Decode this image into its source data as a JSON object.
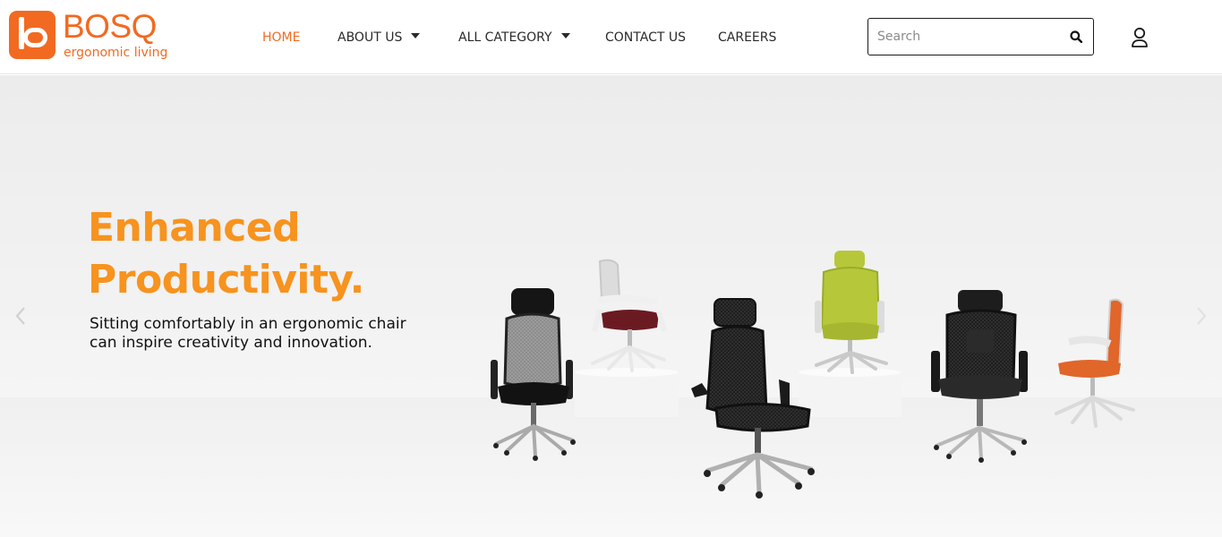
{
  "brand": {
    "name": "BOSQ",
    "tagline": "ergonomic living",
    "color": "#f26a21"
  },
  "nav": {
    "items": [
      {
        "label": "HOME",
        "active": true,
        "dropdown": false
      },
      {
        "label": "ABOUT US",
        "active": false,
        "dropdown": true
      },
      {
        "label": "ALL CATEGORY",
        "active": false,
        "dropdown": true
      },
      {
        "label": "CONTACT US",
        "active": false,
        "dropdown": false
      },
      {
        "label": "CAREERS",
        "active": false,
        "dropdown": false
      }
    ]
  },
  "search": {
    "placeholder": "Search",
    "value": "",
    "icon": "search-icon"
  },
  "account": {
    "icon": "user-icon"
  },
  "hero": {
    "headline_line1": "Enhanced",
    "headline_line2": "Productivity.",
    "subtext_line1": "Sitting comfortably in an ergonomic chair",
    "subtext_line2": "can inspire creativity and innovation.",
    "headline_color": "#f7931e",
    "prev_icon": "chevron-left-icon",
    "next_icon": "chevron-right-icon"
  },
  "products": [
    {
      "name": "grey-mesh-chair",
      "seat_color": "#111111",
      "back_color": "#8c8c8c"
    },
    {
      "name": "white-frame-chair",
      "seat_color": "#6b1a22",
      "back_color": "#f2f2f2"
    },
    {
      "name": "black-mesh-executive-chair",
      "seat_color": "#1a1a1a",
      "back_color": "#1a1a1a"
    },
    {
      "name": "lime-green-chair",
      "seat_color": "#b7c73a",
      "back_color": "#b7c73a"
    },
    {
      "name": "black-headrest-chair",
      "seat_color": "#2a2a2a",
      "back_color": "#202020"
    },
    {
      "name": "orange-task-chair",
      "seat_color": "#e0662a",
      "back_color": "#e0662a"
    }
  ]
}
